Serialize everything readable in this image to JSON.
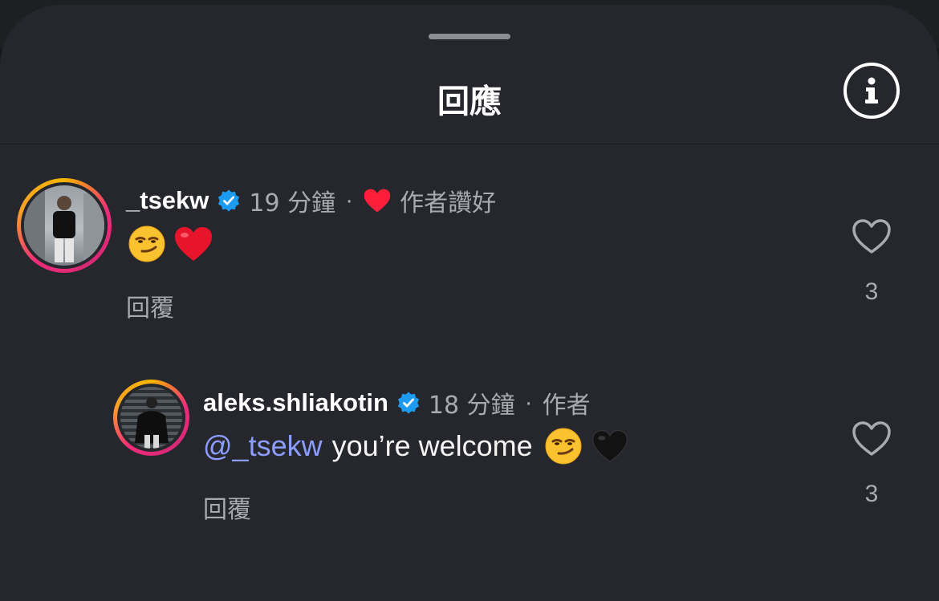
{
  "header": {
    "title": "回應"
  },
  "comments": [
    {
      "username": "_tsekw",
      "time": "19 分鐘",
      "separator": "·",
      "author_badge": "作者讚好",
      "text": "",
      "reply_label": "回覆",
      "likes": "3"
    },
    {
      "username": "aleks.shliakotin",
      "time": "18 分鐘",
      "separator": "·",
      "author_badge": "作者",
      "mention": "@_tsekw",
      "text": "you’re welcome",
      "reply_label": "回覆",
      "likes": "3"
    }
  ],
  "colors": {
    "sheet": "#25272d",
    "verified": "#1d9bf0",
    "mention": "#8c9cff",
    "liked_heart": "#ff1f3a"
  },
  "icons": [
    "info-icon",
    "verified-badge-icon",
    "heart-filled-icon",
    "heart-outline-icon",
    "smirk-emoji",
    "red-heart-emoji",
    "black-heart-emoji"
  ]
}
